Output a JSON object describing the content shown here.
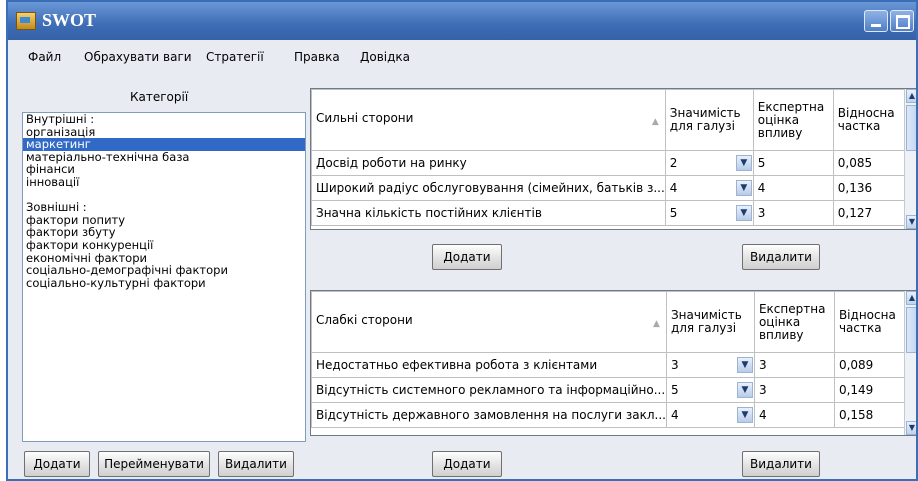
{
  "window": {
    "title": "SWOT"
  },
  "menu": [
    "Файл",
    "Обрахувати ваги",
    "Стратегії",
    "Правка",
    "Довідка"
  ],
  "categories": {
    "label": "Категорії",
    "items": [
      "Внутрішні :",
      "організація",
      "маркетинг",
      "матеріально-технічна база",
      "фінанси",
      "інновації",
      "",
      "Зовнішні :",
      "фактори попиту",
      "фактори збуту",
      "фактори конкуренції",
      "економічні фактори",
      "соціально-демографічні фактори",
      "соціально-культурні фактори"
    ],
    "selected_index": 2
  },
  "left_buttons": {
    "add": "Додати",
    "rename": "Перейменувати",
    "delete": "Видалити"
  },
  "strengths": {
    "columns": [
      "Сильні сторони",
      "Значимість для галузі",
      "Експертна оцінка впливу",
      "Відносна частка"
    ],
    "rows": [
      {
        "name": "Досвід роботи на ринку",
        "importance": "2",
        "rating": "5",
        "share": "0,085"
      },
      {
        "name": "Широкий радіус обслуговування (сімейних, батьків з...",
        "importance": "4",
        "rating": "4",
        "share": "0,136"
      },
      {
        "name": "Значна кількість постійних клієнтів",
        "importance": "5",
        "rating": "3",
        "share": "0,127"
      }
    ],
    "add": "Додати",
    "delete": "Видалити"
  },
  "weaknesses": {
    "columns": [
      "Слабкі сторони",
      "Значимість для галузі",
      "Експертна оцінка впливу",
      "Відносна частка"
    ],
    "rows": [
      {
        "name": "Недостатньо ефективна робота з клієнтами",
        "importance": "3",
        "rating": "3",
        "share": "0,089"
      },
      {
        "name": "Відсутність системного рекламного та інформаційно...",
        "importance": "5",
        "rating": "3",
        "share": "0,149"
      },
      {
        "name": "Відсутність державного замовлення на послуги закл...",
        "importance": "4",
        "rating": "4",
        "share": "0,158"
      }
    ],
    "add": "Додати",
    "delete": "Видалити"
  }
}
